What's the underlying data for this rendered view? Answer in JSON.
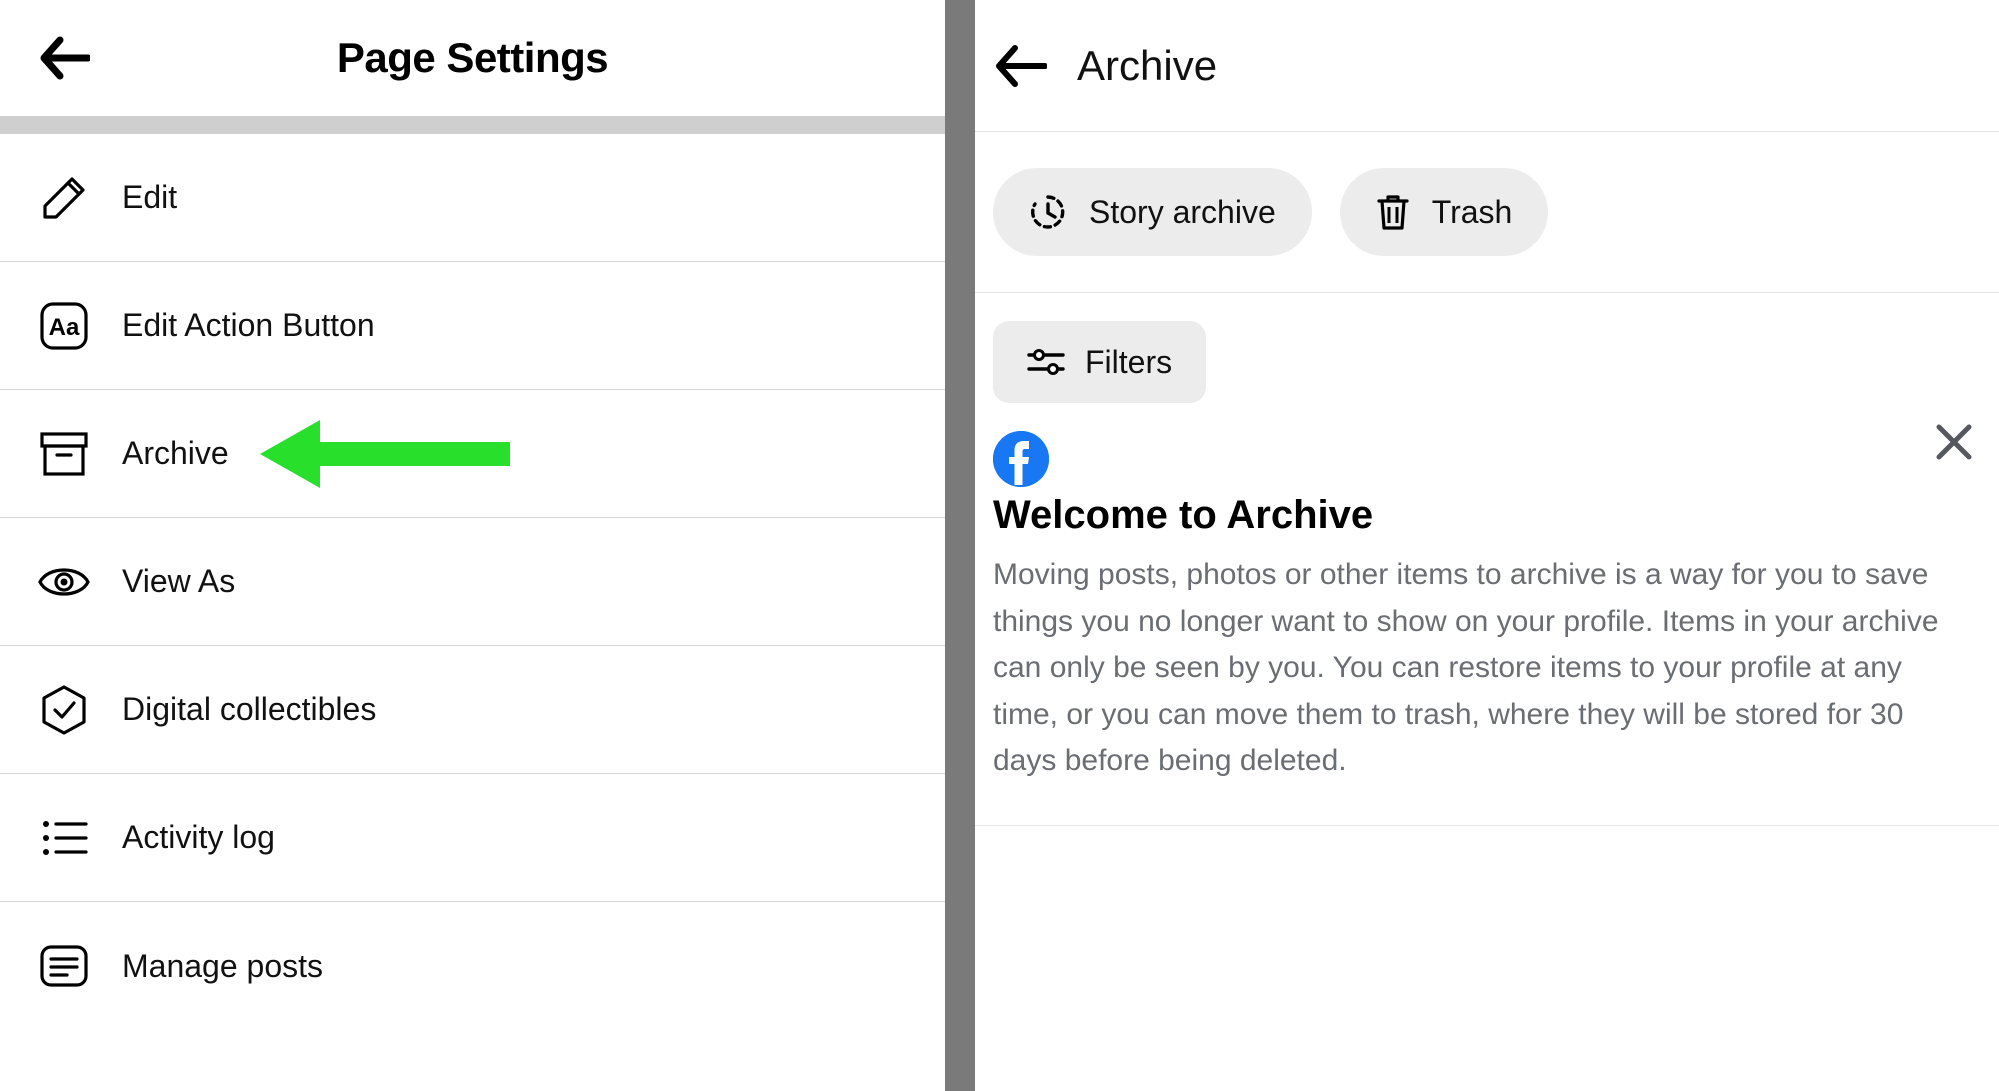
{
  "left": {
    "title": "Page Settings",
    "menu": {
      "edit": "Edit",
      "edit_action_button": "Edit Action Button",
      "archive": "Archive",
      "view_as": "View As",
      "digital_collectibles": "Digital collectibles",
      "activity_log": "Activity log",
      "manage_posts": "Manage posts"
    }
  },
  "right": {
    "title": "Archive",
    "chips": {
      "story_archive": "Story archive",
      "trash": "Trash"
    },
    "filters_label": "Filters",
    "info": {
      "title": "Welcome to Archive",
      "body": "Moving posts, photos or other items to archive is a way for you to save things you no longer want to show on your profile. Items in your archive can only be seen by you. You can restore items to your profile at any time, or you can move them to trash, where they will be stored for 30 days before being deleted."
    }
  },
  "annotation": {
    "arrow_color": "#28E02C"
  }
}
